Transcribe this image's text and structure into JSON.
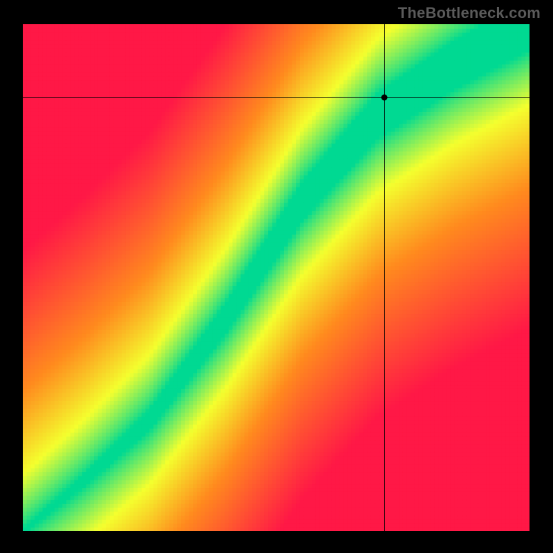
{
  "watermark": "TheBottleneck.com",
  "chart_data": {
    "type": "heatmap",
    "title": "",
    "xlabel": "",
    "ylabel": "",
    "xlim": [
      0,
      100
    ],
    "ylim": [
      0,
      100
    ],
    "grid": false,
    "legend": false,
    "crosshair": {
      "x": 71.3,
      "y": 85.5
    },
    "marker": {
      "x": 71.3,
      "y": 85.5
    },
    "color_scale": [
      {
        "value": 0.0,
        "color": "#00d992"
      },
      {
        "value": 0.25,
        "color": "#f4ff2e"
      },
      {
        "value": 0.55,
        "color": "#ff8a1e"
      },
      {
        "value": 1.0,
        "color": "#ff1846"
      }
    ],
    "optimal_band": {
      "description": "Green band follows an S-curve from bottom-left to top-right; deviation from it maps through yellow and orange to red.",
      "control_points": [
        {
          "x": 0,
          "center_y": 0,
          "half_width": 0.5
        },
        {
          "x": 12,
          "center_y": 10,
          "half_width": 1.2
        },
        {
          "x": 25,
          "center_y": 22,
          "half_width": 2.0
        },
        {
          "x": 40,
          "center_y": 42,
          "half_width": 3.0
        },
        {
          "x": 55,
          "center_y": 65,
          "half_width": 3.8
        },
        {
          "x": 70,
          "center_y": 82,
          "half_width": 4.5
        },
        {
          "x": 85,
          "center_y": 92,
          "half_width": 4.8
        },
        {
          "x": 100,
          "center_y": 100,
          "half_width": 5.0
        }
      ]
    },
    "resolution": {
      "nx": 128,
      "ny": 128
    }
  }
}
